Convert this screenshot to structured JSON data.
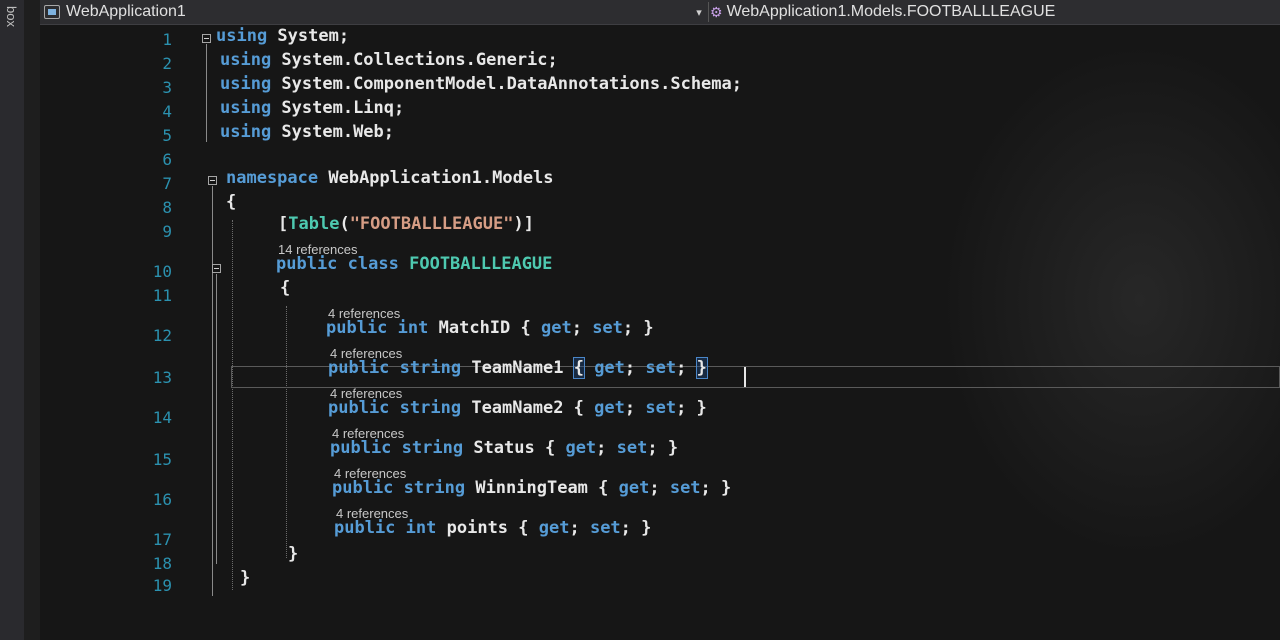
{
  "toolbox_label": "box",
  "navbar": {
    "project": "WebApplication1",
    "type_path": "WebApplication1.Models.FOOTBALLLEAGUE",
    "dropdown_glyph": "▾"
  },
  "lines": [
    {
      "n": "1",
      "tokens": [
        [
          "kw",
          "using"
        ],
        [
          "txt",
          " System;"
        ]
      ]
    },
    {
      "n": "2",
      "tokens": [
        [
          "kw",
          "using"
        ],
        [
          "txt",
          " System.Collections.Generic;"
        ]
      ]
    },
    {
      "n": "3",
      "tokens": [
        [
          "kw",
          "using"
        ],
        [
          "txt",
          " System.ComponentModel.DataAnnotations.Schema;"
        ]
      ]
    },
    {
      "n": "4",
      "tokens": [
        [
          "kw",
          "using"
        ],
        [
          "txt",
          " System.Linq;"
        ]
      ]
    },
    {
      "n": "5",
      "tokens": [
        [
          "kw",
          "using"
        ],
        [
          "txt",
          " System.Web;"
        ]
      ]
    },
    {
      "n": "6",
      "tokens": []
    },
    {
      "n": "7",
      "tokens": [
        [
          "kw",
          "namespace"
        ],
        [
          "txt",
          " WebApplication1.Models"
        ]
      ]
    },
    {
      "n": "8",
      "tokens": [
        [
          "txt",
          "{"
        ]
      ]
    },
    {
      "n": "9",
      "tokens": [
        [
          "txt",
          "["
        ],
        [
          "ty",
          "Table"
        ],
        [
          "txt",
          "("
        ],
        [
          "str",
          "\"FOOTBALLLEAGUE\""
        ],
        [
          "txt",
          ")]"
        ]
      ]
    },
    {
      "n": "10",
      "lens": "14 references",
      "tokens": [
        [
          "kw",
          "public"
        ],
        [
          "txt",
          " "
        ],
        [
          "kw",
          "class"
        ],
        [
          "txt",
          " "
        ],
        [
          "ty",
          "FOOTBALLLEAGUE"
        ]
      ]
    },
    {
      "n": "11",
      "tokens": [
        [
          "txt",
          "{"
        ]
      ]
    },
    {
      "n": "12",
      "lens": "4 references",
      "tokens": [
        [
          "kw",
          "public"
        ],
        [
          "txt",
          " "
        ],
        [
          "kw",
          "int"
        ],
        [
          "txt",
          " MatchID { "
        ],
        [
          "kw",
          "get"
        ],
        [
          "txt",
          "; "
        ],
        [
          "kw",
          "set"
        ],
        [
          "txt",
          "; }"
        ]
      ]
    },
    {
      "n": "13",
      "lens": "4 references",
      "tokens": [
        [
          "kw",
          "public"
        ],
        [
          "txt",
          " "
        ],
        [
          "kw",
          "string"
        ],
        [
          "txt",
          " TeamName1 "
        ],
        [
          "hl",
          "{"
        ],
        [
          "txt",
          " "
        ],
        [
          "kw",
          "get"
        ],
        [
          "txt",
          "; "
        ],
        [
          "kw",
          "set"
        ],
        [
          "txt",
          "; "
        ],
        [
          "hl",
          "}"
        ]
      ]
    },
    {
      "n": "14",
      "lens": "4 references",
      "tokens": [
        [
          "kw",
          "public"
        ],
        [
          "txt",
          " "
        ],
        [
          "kw",
          "string"
        ],
        [
          "txt",
          " TeamName2 { "
        ],
        [
          "kw",
          "get"
        ],
        [
          "txt",
          "; "
        ],
        [
          "kw",
          "set"
        ],
        [
          "txt",
          "; }"
        ]
      ]
    },
    {
      "n": "15",
      "lens": "4 references",
      "tokens": [
        [
          "kw",
          "public"
        ],
        [
          "txt",
          " "
        ],
        [
          "kw",
          "string"
        ],
        [
          "txt",
          " Status { "
        ],
        [
          "kw",
          "get"
        ],
        [
          "txt",
          "; "
        ],
        [
          "kw",
          "set"
        ],
        [
          "txt",
          "; }"
        ]
      ]
    },
    {
      "n": "16",
      "lens": "4 references",
      "tokens": [
        [
          "kw",
          "public"
        ],
        [
          "txt",
          " "
        ],
        [
          "kw",
          "string"
        ],
        [
          "txt",
          " WinningTeam { "
        ],
        [
          "kw",
          "get"
        ],
        [
          "txt",
          "; "
        ],
        [
          "kw",
          "set"
        ],
        [
          "txt",
          "; }"
        ]
      ]
    },
    {
      "n": "17",
      "lens": "4 references",
      "tokens": [
        [
          "kw",
          "public"
        ],
        [
          "txt",
          " "
        ],
        [
          "kw",
          "int"
        ],
        [
          "txt",
          " points { "
        ],
        [
          "kw",
          "get"
        ],
        [
          "txt",
          "; "
        ],
        [
          "kw",
          "set"
        ],
        [
          "txt",
          "; }"
        ]
      ]
    },
    {
      "n": "18",
      "tokens": [
        [
          "txt",
          "}"
        ]
      ]
    },
    {
      "n": "19",
      "tokens": [
        [
          "txt",
          "}"
        ]
      ]
    }
  ],
  "colors": {
    "keyword": "#569cd6",
    "type": "#4ec9b0",
    "string": "#d69d85",
    "line_number": "#2b91af",
    "background": "#161616"
  }
}
